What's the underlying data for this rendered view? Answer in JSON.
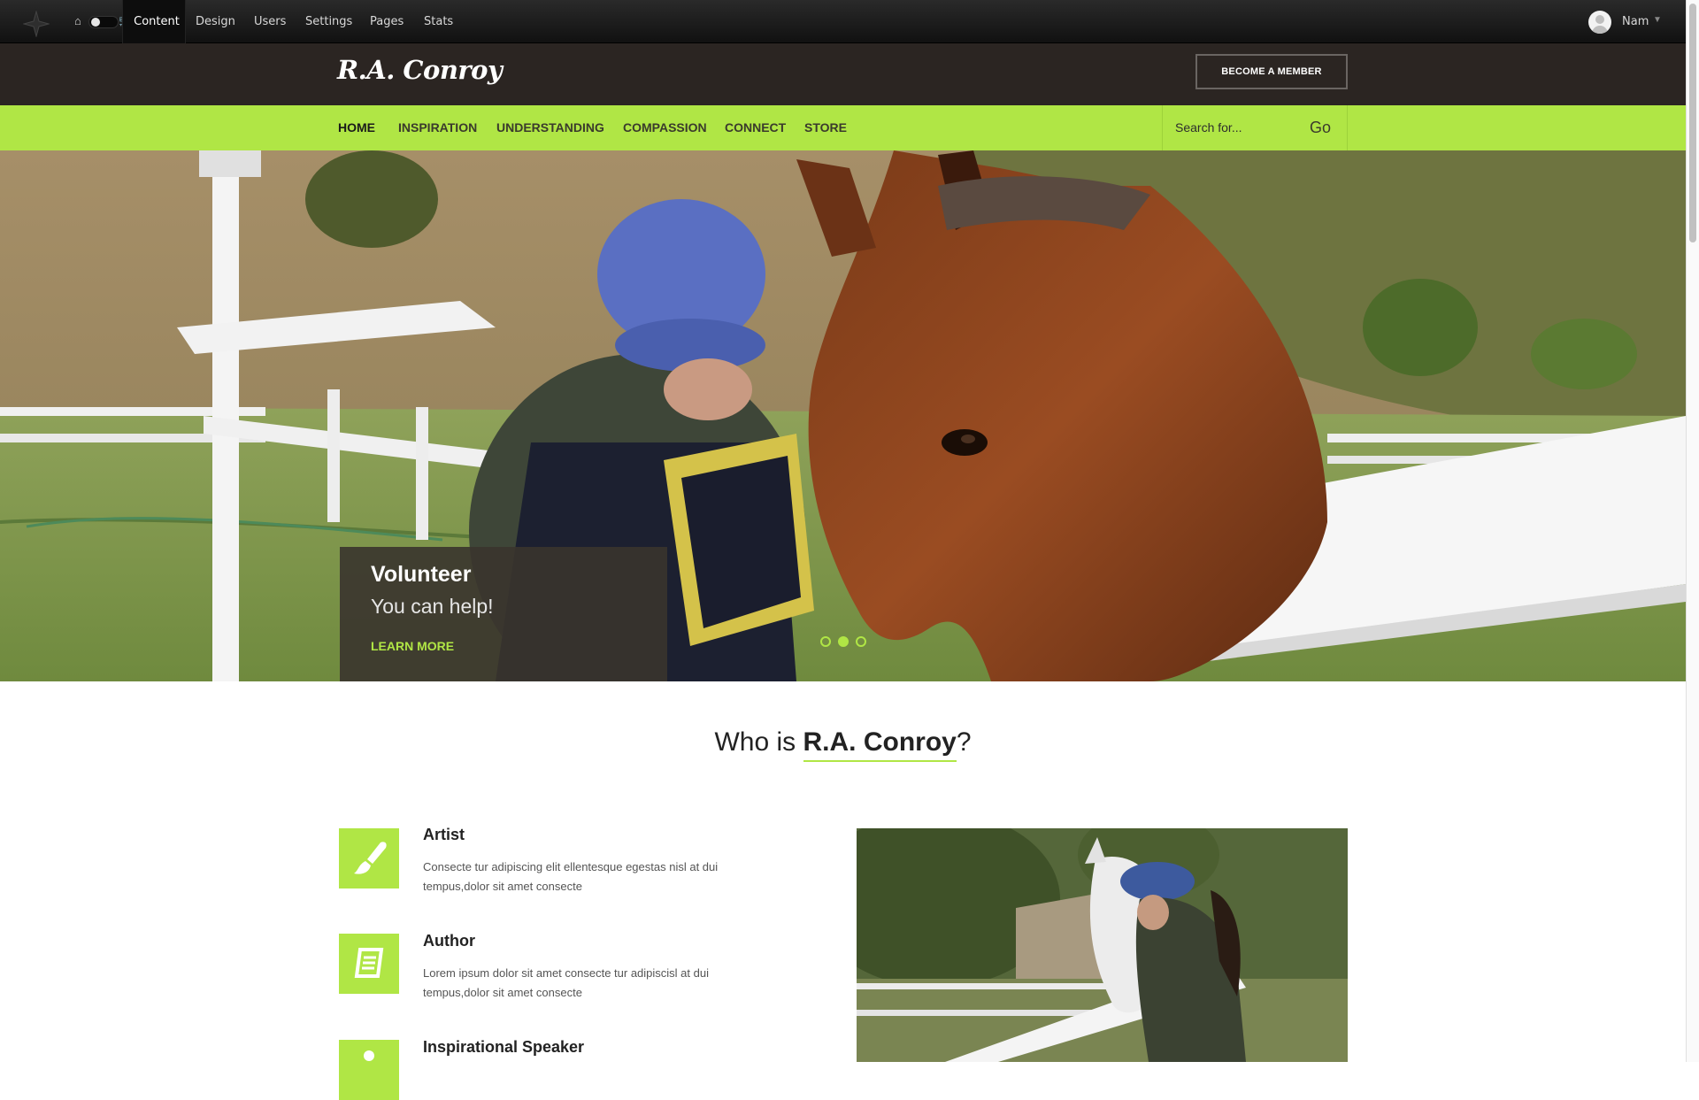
{
  "cms_toolbar": {
    "menu": [
      "Content",
      "Design",
      "Users",
      "Settings",
      "Pages",
      "Stats"
    ],
    "user_name": "Nam"
  },
  "header": {
    "site_title": "R.A. Conroy",
    "member_button": "BECOME A MEMBER"
  },
  "nav": {
    "items": [
      "HOME",
      "INSPIRATION",
      "UNDERSTANDING",
      "COMPASSION",
      "CONNECT",
      "STORE"
    ],
    "active": "HOME",
    "search_placeholder": "Search for...",
    "search_button": "Go"
  },
  "hero": {
    "slide_title": "Volunteer",
    "slide_subtitle": "You can help!",
    "slide_link": "LEARN MORE",
    "slide_count": 3,
    "active_slide": 2
  },
  "about": {
    "heading_prefix": "Who is ",
    "heading_name": "R.A. Conroy",
    "heading_suffix": "?",
    "features": [
      {
        "title": "Artist",
        "text": "Consecte tur adipiscing elit ellentesque egestas nisl at dui tempus,dolor sit amet consecte",
        "icon": "paintbrush-icon"
      },
      {
        "title": "Author",
        "text": "Lorem ipsum dolor sit amet consecte tur adipiscisl at dui tempus,dolor sit amet consecte",
        "icon": "book-icon"
      },
      {
        "title": "Inspirational Speaker",
        "text": "",
        "icon": "speaker-icon"
      }
    ]
  },
  "colors": {
    "accent": "#b0e645",
    "header_bg": "#2b2522",
    "toolbar_bg": "#111111"
  }
}
